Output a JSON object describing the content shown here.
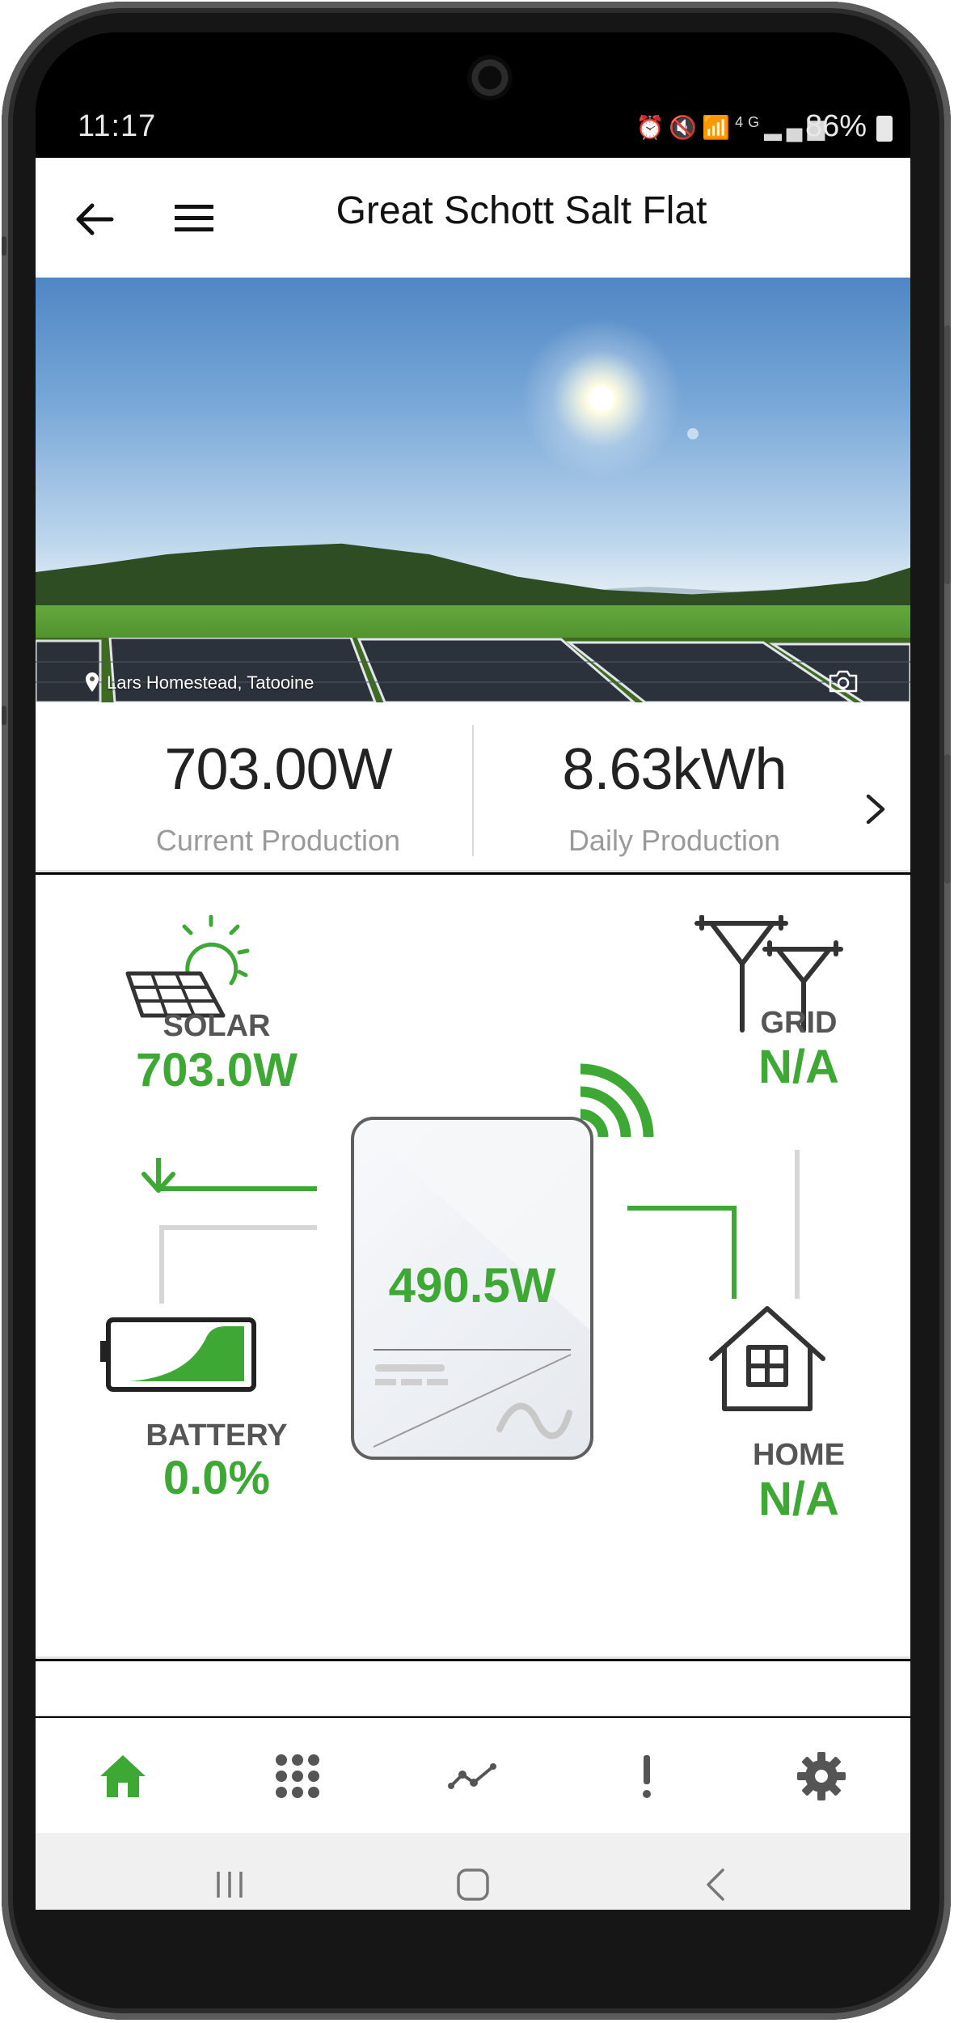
{
  "status_bar": {
    "time": "11:17",
    "battery": "86%",
    "network": "4G"
  },
  "app_bar": {
    "title": "Great Schott Salt Flat"
  },
  "hero": {
    "location": "Lars Homestead, Tatooine"
  },
  "production": {
    "current_value": "703.00W",
    "current_label": "Current Production",
    "daily_value": "8.63kWh",
    "daily_label": "Daily Production"
  },
  "flow": {
    "solar": {
      "name": "SOLAR",
      "value": "703.0W"
    },
    "grid": {
      "name": "GRID",
      "value": "N/A"
    },
    "battery": {
      "name": "BATTERY",
      "value": "0.0%",
      "level": 0.0
    },
    "home": {
      "name": "HOME",
      "value": "N/A"
    },
    "inverter": {
      "value": "490.5W"
    }
  },
  "bottom_nav": {
    "items": [
      "home-icon",
      "grid-dots-icon",
      "chart-line-icon",
      "alert-icon",
      "gear-icon"
    ],
    "active": "home-icon"
  },
  "colors": {
    "accent_green": "#3ea835",
    "icon_grey": "#5a5a5a",
    "wire_grey": "#d6d6d6"
  }
}
